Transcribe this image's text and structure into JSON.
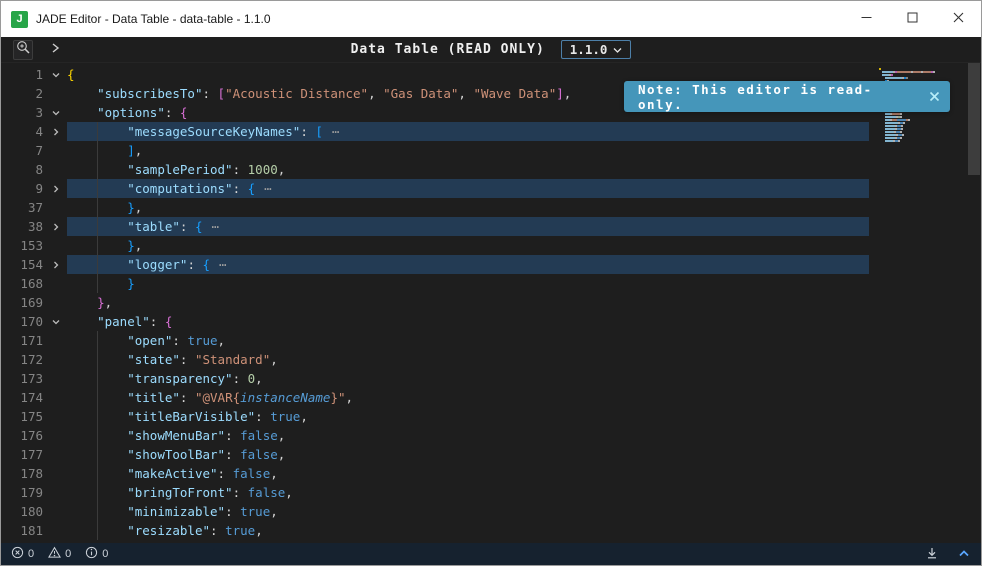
{
  "window": {
    "title": "JADE Editor - Data Table - data-table - 1.1.0",
    "logo_text": "J"
  },
  "toolbar": {
    "doc_title": "Data Table (READ ONLY)",
    "version_label": "1.1.0"
  },
  "toast": {
    "message": "Note: This editor is read-only."
  },
  "status_bar": {
    "error_count": "0",
    "warning_count": "0",
    "info_count": "0"
  },
  "colors": {
    "titlebar_bg": "#ffffff",
    "editor_bg": "#1e1e1e",
    "toast_bg": "#4596ba",
    "statusbar_bg": "#16222f",
    "logo_green": "#27a548",
    "fold_highlight": "#264f78",
    "syntax": {
      "key": "#9cdcfe",
      "str": "#ce9178",
      "num": "#b5cea8",
      "kw": "#569cd6",
      "pn": "#d4d4d4",
      "b0": "#ffd700",
      "b1": "#da70d6",
      "b2": "#179fff",
      "var": "#569cd6",
      "fold": "#9d9d9d",
      "ws": "transparent"
    }
  },
  "editor": {
    "lines": [
      {
        "n": "1",
        "fold": "down",
        "hl": false,
        "tokens": [
          [
            "b0",
            "{"
          ]
        ]
      },
      {
        "n": "2",
        "fold": "",
        "hl": false,
        "tokens": [
          [
            "ws",
            "    "
          ],
          [
            "key",
            "\"subscribesTo\""
          ],
          [
            "pn",
            ": "
          ],
          [
            "b1",
            "["
          ],
          [
            "str",
            "\"Acoustic Distance\""
          ],
          [
            "pn",
            ", "
          ],
          [
            "str",
            "\"Gas Data\""
          ],
          [
            "pn",
            ", "
          ],
          [
            "str",
            "\"Wave Data\""
          ],
          [
            "b1",
            "]"
          ],
          [
            "pn",
            ","
          ]
        ]
      },
      {
        "n": "3",
        "fold": "down",
        "hl": false,
        "tokens": [
          [
            "ws",
            "    "
          ],
          [
            "key",
            "\"options\""
          ],
          [
            "pn",
            ": "
          ],
          [
            "b1",
            "{"
          ]
        ]
      },
      {
        "n": "4",
        "fold": "right",
        "hl": true,
        "tokens": [
          [
            "ws",
            "        "
          ],
          [
            "key",
            "\"messageSourceKeyNames\""
          ],
          [
            "pn",
            ": "
          ],
          [
            "b2",
            "["
          ],
          [
            "fold",
            "⋯"
          ]
        ]
      },
      {
        "n": "7",
        "fold": "",
        "hl": false,
        "tokens": [
          [
            "ws",
            "        "
          ],
          [
            "b2",
            "]"
          ],
          [
            "pn",
            ","
          ]
        ]
      },
      {
        "n": "8",
        "fold": "",
        "hl": false,
        "tokens": [
          [
            "ws",
            "        "
          ],
          [
            "key",
            "\"samplePeriod\""
          ],
          [
            "pn",
            ": "
          ],
          [
            "num",
            "1000"
          ],
          [
            "pn",
            ","
          ]
        ]
      },
      {
        "n": "9",
        "fold": "right",
        "hl": true,
        "tokens": [
          [
            "ws",
            "        "
          ],
          [
            "key",
            "\"computations\""
          ],
          [
            "pn",
            ": "
          ],
          [
            "b2",
            "{"
          ],
          [
            "fold",
            "⋯"
          ]
        ]
      },
      {
        "n": "37",
        "fold": "",
        "hl": false,
        "tokens": [
          [
            "ws",
            "        "
          ],
          [
            "b2",
            "}"
          ],
          [
            "pn",
            ","
          ]
        ]
      },
      {
        "n": "38",
        "fold": "right",
        "hl": true,
        "tokens": [
          [
            "ws",
            "        "
          ],
          [
            "key",
            "\"table\""
          ],
          [
            "pn",
            ": "
          ],
          [
            "b2",
            "{"
          ],
          [
            "fold",
            "⋯"
          ]
        ]
      },
      {
        "n": "153",
        "fold": "",
        "hl": false,
        "tokens": [
          [
            "ws",
            "        "
          ],
          [
            "b2",
            "}"
          ],
          [
            "pn",
            ","
          ]
        ]
      },
      {
        "n": "154",
        "fold": "right",
        "hl": true,
        "tokens": [
          [
            "ws",
            "        "
          ],
          [
            "key",
            "\"logger\""
          ],
          [
            "pn",
            ": "
          ],
          [
            "b2",
            "{"
          ],
          [
            "fold",
            "⋯"
          ]
        ]
      },
      {
        "n": "168",
        "fold": "",
        "hl": false,
        "tokens": [
          [
            "ws",
            "        "
          ],
          [
            "b2",
            "}"
          ]
        ]
      },
      {
        "n": "169",
        "fold": "",
        "hl": false,
        "tokens": [
          [
            "ws",
            "    "
          ],
          [
            "b1",
            "}"
          ],
          [
            "pn",
            ","
          ]
        ]
      },
      {
        "n": "170",
        "fold": "down",
        "hl": false,
        "tokens": [
          [
            "ws",
            "    "
          ],
          [
            "key",
            "\"panel\""
          ],
          [
            "pn",
            ": "
          ],
          [
            "b1",
            "{"
          ]
        ]
      },
      {
        "n": "171",
        "fold": "",
        "hl": false,
        "tokens": [
          [
            "ws",
            "        "
          ],
          [
            "key",
            "\"open\""
          ],
          [
            "pn",
            ": "
          ],
          [
            "kw",
            "true"
          ],
          [
            "pn",
            ","
          ]
        ]
      },
      {
        "n": "172",
        "fold": "",
        "hl": false,
        "tokens": [
          [
            "ws",
            "        "
          ],
          [
            "key",
            "\"state\""
          ],
          [
            "pn",
            ": "
          ],
          [
            "str",
            "\"Standard\""
          ],
          [
            "pn",
            ","
          ]
        ]
      },
      {
        "n": "173",
        "fold": "",
        "hl": false,
        "tokens": [
          [
            "ws",
            "        "
          ],
          [
            "key",
            "\"transparency\""
          ],
          [
            "pn",
            ": "
          ],
          [
            "num",
            "0"
          ],
          [
            "pn",
            ","
          ]
        ]
      },
      {
        "n": "174",
        "fold": "",
        "hl": false,
        "tokens": [
          [
            "ws",
            "        "
          ],
          [
            "key",
            "\"title\""
          ],
          [
            "pn",
            ": "
          ],
          [
            "str",
            "\"@VAR{"
          ],
          [
            "var",
            "instanceName"
          ],
          [
            "str",
            "}\""
          ],
          [
            "pn",
            ","
          ]
        ]
      },
      {
        "n": "175",
        "fold": "",
        "hl": false,
        "tokens": [
          [
            "ws",
            "        "
          ],
          [
            "key",
            "\"titleBarVisible\""
          ],
          [
            "pn",
            ": "
          ],
          [
            "kw",
            "true"
          ],
          [
            "pn",
            ","
          ]
        ]
      },
      {
        "n": "176",
        "fold": "",
        "hl": false,
        "tokens": [
          [
            "ws",
            "        "
          ],
          [
            "key",
            "\"showMenuBar\""
          ],
          [
            "pn",
            ": "
          ],
          [
            "kw",
            "false"
          ],
          [
            "pn",
            ","
          ]
        ]
      },
      {
        "n": "177",
        "fold": "",
        "hl": false,
        "tokens": [
          [
            "ws",
            "        "
          ],
          [
            "key",
            "\"showToolBar\""
          ],
          [
            "pn",
            ": "
          ],
          [
            "kw",
            "false"
          ],
          [
            "pn",
            ","
          ]
        ]
      },
      {
        "n": "178",
        "fold": "",
        "hl": false,
        "tokens": [
          [
            "ws",
            "        "
          ],
          [
            "key",
            "\"makeActive\""
          ],
          [
            "pn",
            ": "
          ],
          [
            "kw",
            "false"
          ],
          [
            "pn",
            ","
          ]
        ]
      },
      {
        "n": "179",
        "fold": "",
        "hl": false,
        "tokens": [
          [
            "ws",
            "        "
          ],
          [
            "key",
            "\"bringToFront\""
          ],
          [
            "pn",
            ": "
          ],
          [
            "kw",
            "false"
          ],
          [
            "pn",
            ","
          ]
        ]
      },
      {
        "n": "180",
        "fold": "",
        "hl": false,
        "tokens": [
          [
            "ws",
            "        "
          ],
          [
            "key",
            "\"minimizable\""
          ],
          [
            "pn",
            ": "
          ],
          [
            "kw",
            "true"
          ],
          [
            "pn",
            ","
          ]
        ]
      },
      {
        "n": "181",
        "fold": "",
        "hl": false,
        "tokens": [
          [
            "ws",
            "        "
          ],
          [
            "key",
            "\"resizable\""
          ],
          [
            "pn",
            ": "
          ],
          [
            "kw",
            "true"
          ],
          [
            "pn",
            ","
          ]
        ]
      }
    ]
  }
}
